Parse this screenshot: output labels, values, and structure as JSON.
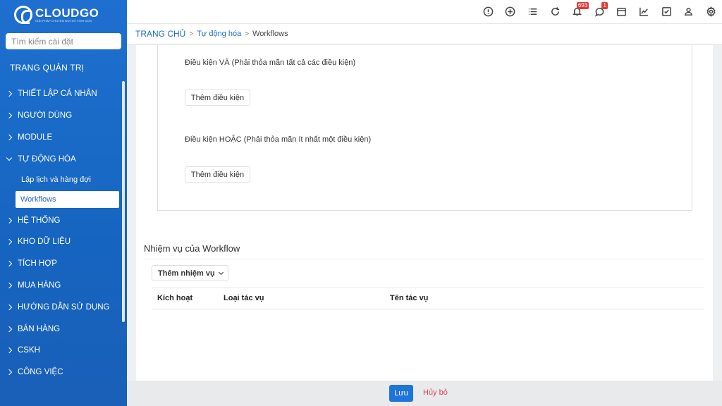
{
  "brand": {
    "name": "CLOUDGO",
    "tagline": "GIẢI PHÁP CHUYỂN ĐỔI SỐ TINH GỌN"
  },
  "search": {
    "placeholder": "Tìm kiếm cài đặt"
  },
  "sidebar": {
    "title": "TRANG QUẢN TRỊ",
    "items": [
      {
        "label": "THIẾT LẬP CÁ NHÂN"
      },
      {
        "label": "NGƯỜI DÙNG"
      },
      {
        "label": "MODULE"
      },
      {
        "label": "TỰ ĐỘNG HÓA"
      },
      {
        "label": "HỆ THỐNG"
      },
      {
        "label": "KHO DỮ LIỆU"
      },
      {
        "label": "TÍCH HỢP"
      },
      {
        "label": "MUA HÀNG"
      },
      {
        "label": "HƯỚNG DẪN SỬ DỤNG"
      },
      {
        "label": "BÁN HÀNG"
      },
      {
        "label": "CSKH"
      },
      {
        "label": "CÔNG VIỆC"
      }
    ],
    "subitems": [
      {
        "label": "Lập lịch và hàng đợi"
      },
      {
        "label": "Workflows"
      }
    ]
  },
  "topbar": {
    "icons": [
      "alert-icon",
      "add-icon",
      "list-icon",
      "refresh-icon",
      "bell-icon",
      "chat-icon",
      "calendar-icon",
      "chart-icon",
      "task-icon",
      "user-icon",
      "settings-icon"
    ],
    "notifications_count": "693",
    "messages_count": "1"
  },
  "breadcrumb": {
    "home": "TRANG CHỦ",
    "parent": "Tự động hóa",
    "current": "Workflows"
  },
  "conditions": {
    "and_label": "Điều kiện VÀ  (Phải thỏa mãn tất cả các điều kiện)",
    "or_label": "Điều kiện HOẶC  (Phải thỏa mãn ít nhất một điều kiện)",
    "add_button": "Thêm điều kiện"
  },
  "tasks": {
    "title": "Nhiệm vụ của Workflow",
    "add_button": "Thêm nhiệm vụ",
    "columns": [
      "Kích hoạt",
      "Loại tác vụ",
      "Tên tác vụ"
    ]
  },
  "footer": {
    "save": "Lưu",
    "cancel": "Hủy bỏ"
  }
}
